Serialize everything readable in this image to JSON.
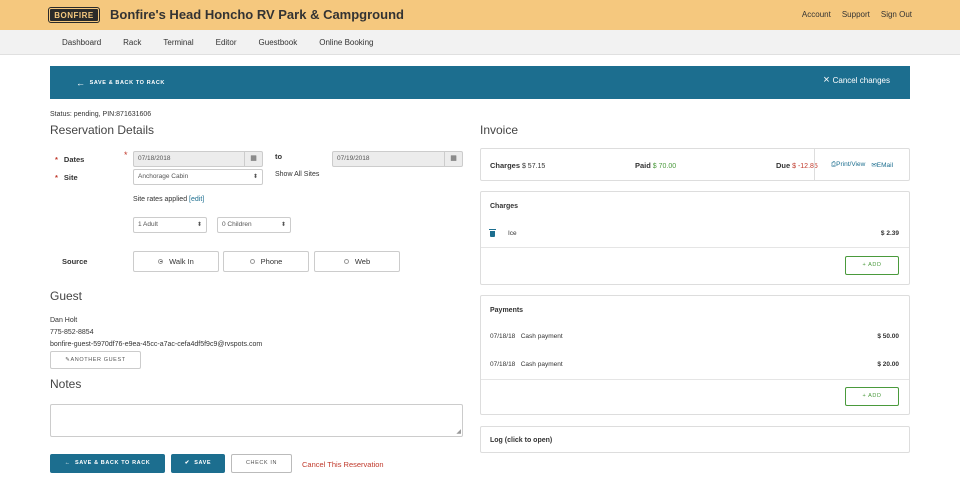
{
  "app": {
    "logo": "BONFIRE",
    "park_name": "Bonfire's Head Honcho RV Park & Campground",
    "top_links": [
      "Account",
      "Support",
      "Sign Out"
    ]
  },
  "nav": [
    "Dashboard",
    "Rack",
    "Terminal",
    "Editor",
    "Guestbook",
    "Online Booking"
  ],
  "actionbar": {
    "save_back": "SAVE & BACK TO RACK",
    "cancel_changes": "Cancel changes"
  },
  "status": "Status: pending, PIN:871631606",
  "reservation": {
    "title": "Reservation Details",
    "dates_label": "Dates",
    "date_from": "07/18/2018",
    "to_label": "to",
    "date_to": "07/19/2018",
    "site_label": "Site",
    "site_value": "Anchorage Cabin",
    "show_all_sites": "Show All Sites",
    "rates_text": "Site rates applied",
    "rates_edit": "[edit]",
    "adults": "1 Adult",
    "children": "0 Children",
    "source_label": "Source",
    "sources": [
      "Walk In",
      "Phone",
      "Web"
    ],
    "selected_source": "Walk In"
  },
  "guest": {
    "title": "Guest",
    "name": "Dan Holt",
    "phone": "775-852-8854",
    "email": "bonfire-guest-5970df76-e9ea-45cc-a7ac-cefa4df5f9c9@rvspots.com",
    "another_guest": "ANOTHER GUEST"
  },
  "notes": {
    "title": "Notes",
    "value": ""
  },
  "bottom_actions": {
    "save_back": "SAVE & BACK TO RACK",
    "save": "SAVE",
    "check_in": "CHECK IN",
    "cancel_reservation": "Cancel This Reservation"
  },
  "invoice": {
    "title": "Invoice",
    "charges_label": "Charges",
    "charges_total": "$ 57.15",
    "paid_label": "Paid",
    "paid_total": "$ 70.00",
    "due_label": "Due",
    "due_total": "$ -12.85",
    "print_view": "Print/View",
    "email": "EMail",
    "charges_panel": {
      "title": "Charges",
      "items": [
        {
          "name": "Ice",
          "amount": "$ 2.39"
        }
      ],
      "add": "+ ADD"
    },
    "payments_panel": {
      "title": "Payments",
      "items": [
        {
          "date": "07/18/18",
          "desc": "Cash payment",
          "amount": "$ 50.00"
        },
        {
          "date": "07/18/18",
          "desc": "Cash payment",
          "amount": "$ 20.00"
        }
      ],
      "add": "+ ADD"
    },
    "log": "Log (click to open)"
  },
  "colors": {
    "topbar": "#f5c87e",
    "primary": "#1c6e8f",
    "positive": "#4a9a3c",
    "negative": "#c0392b"
  }
}
